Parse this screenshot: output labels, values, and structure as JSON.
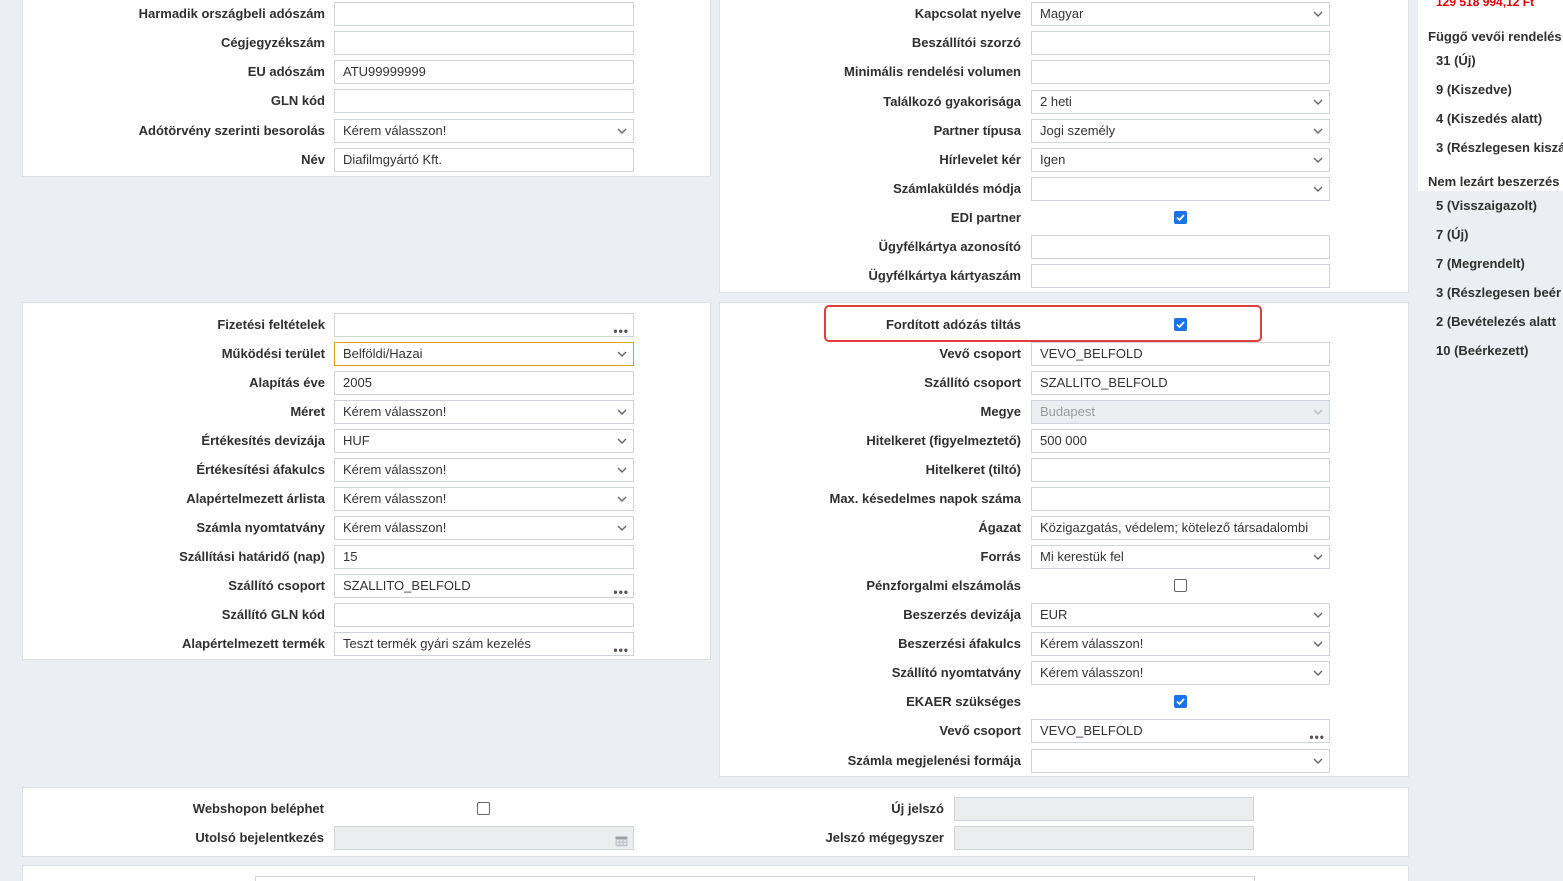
{
  "colors": {
    "accent": "#1a73e8",
    "highlight": "#e23c3c",
    "amount": "#e00000",
    "focus": "#e3a21a"
  },
  "panel1": {
    "harmadik_label": "Harmadik országbeli adószám",
    "harmadik_value": "",
    "cegjegyzek_label": "Cégjegyzékszám",
    "cegjegyzek_value": "",
    "eu_label": "EU adószám",
    "eu_value": "ATU99999999",
    "gln_label": "GLN kód",
    "gln_value": "",
    "adotorveny_label": "Adótörvény szerinti besorolás",
    "adotorveny_value": "Kérem válasszon!",
    "nev_label": "Név",
    "nev_value": "Diafilmgyártó Kft."
  },
  "panel2": {
    "kapcsolat_label": "Kapcsolat nyelve",
    "kapcsolat_value": "Magyar",
    "szorzo_label": "Beszállítói szorzó",
    "szorzo_value": "",
    "minimalis_label": "Minimális rendelési volumen",
    "minimalis_value": "",
    "talalkozo_label": "Találkozó gyakorisága",
    "talalkozo_value": "2 heti",
    "partner_label": "Partner típusa",
    "partner_value": "Jogi személy",
    "hirlevel_label": "Hírlevelet kér",
    "hirlevel_value": "Igen",
    "szamlakuldes_label": "Számlaküldés módja",
    "szamlakuldes_value": "",
    "edi_label": "EDI partner",
    "ugyfelkartya_label": "Ügyfélkártya azonosító",
    "ugyfelkartya_value": "",
    "kartyaszam_label": "Ügyfélkártya kártyaszám",
    "kartyaszam_value": ""
  },
  "panel3": {
    "fizetesi_label": "Fizetési feltételek",
    "fizetesi_value": "",
    "mukodesi_label": "Működési terület",
    "mukodesi_value": "Belföldi/Hazai",
    "alapitas_label": "Alapítás éve",
    "alapitas_value": "2005",
    "meret_label": "Méret",
    "meret_value": "Kérem válasszon!",
    "deviza_label": "Értékesítés devizája",
    "deviza_value": "HUF",
    "afakulcs_label": "Értékesítési áfakulcs",
    "afakulcs_value": "Kérem válasszon!",
    "arlista_label": "Alapértelmezett árlista",
    "arlista_value": "Kérem válasszon!",
    "nyomtatvany_label": "Számla nyomtatvány",
    "nyomtatvany_value": "Kérem válasszon!",
    "hatarido_label": "Szállítási határidő (nap)",
    "hatarido_value": "15",
    "szallito_csoport_label": "Szállító csoport",
    "szallito_csoport_value": "SZALLITO_BELFOLD",
    "szallito_gln_label": "Szállító GLN kód",
    "szallito_gln_value": "",
    "termek_label": "Alapértelmezett termék",
    "termek_value": "Teszt termék gyári szám kezelés"
  },
  "panel4": {
    "forditott_label": "Fordított adózás tiltás",
    "vevo_label": "Vevő csoport",
    "vevo_value": "VEVO_BELFOLD",
    "szallito_label": "Szállító csoport",
    "szallito_value": "SZALLITO_BELFOLD",
    "megye_label": "Megye",
    "megye_value": "Budapest",
    "hitelkeret_f_label": "Hitelkeret (figyelmeztető)",
    "hitelkeret_f_value": "500 000",
    "hitelkeret_t_label": "Hitelkeret (tiltó)",
    "hitelkeret_t_value": "",
    "kesedelmes_label": "Max. késedelmes napok száma",
    "kesedelmes_value": "",
    "agazat_label": "Ágazat",
    "agazat_value": "Közigazgatás, védelem; kötelező társadalombi",
    "forras_label": "Forrás",
    "forras_value": "Mi kerestük fel",
    "penzforgalmi_label": "Pénzforgalmi elszámolás",
    "beszerzes_deviza_label": "Beszerzés devizája",
    "beszerzes_deviza_value": "EUR",
    "beszerzes_afa_label": "Beszerzési áfakulcs",
    "beszerzes_afa_value": "Kérem válasszon!",
    "szallito_nyomtatvany_label": "Szállító nyomtatvány",
    "szallito_nyomtatvany_value": "Kérem válasszon!",
    "ekaer_label": "EKAER szükséges",
    "vevo2_label": "Vevő csoport",
    "vevo2_value": "VEVO_BELFOLD",
    "megjelenesi_label": "Számla megjelenési formája",
    "megjelenesi_value": ""
  },
  "panel5": {
    "webshop_label": "Webshopon beléphet",
    "utolso_label": "Utolsó bejelentkezés",
    "utolso_value": "",
    "uj_jelszo_label": "Új jelszó",
    "uj_jelszo_value": "",
    "jelszo_ujra_label": "Jelszó mégegyszer",
    "jelszo_ujra_value": ""
  },
  "sidebar": {
    "amount": "129 518 994,12 Ft",
    "pending_heading": "Függő vevői rendelés",
    "pending_items": [
      "31 (Új)",
      "9 (Kiszedve)",
      "4 (Kiszedés alatt)",
      "3 (Részlegesen kiszá"
    ],
    "open_heading": "Nem lezárt beszerzés",
    "open_items": [
      "5 (Visszaigazolt)",
      "7 (Új)",
      "7 (Megrendelt)",
      "3 (Részlegesen beér",
      "2 (Bevételezés alatt",
      "10 (Beérkezett)"
    ]
  }
}
